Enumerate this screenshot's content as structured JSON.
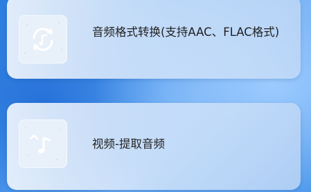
{
  "items": [
    {
      "label": "音频格式转换(支持AAC、FLAC格式)",
      "icon": "audio-convert-icon"
    },
    {
      "label": "视频-提取音频",
      "icon": "music-note-icon"
    }
  ],
  "colors": {
    "background_blue": "#3f8fe8",
    "card_background": "#dde9f8",
    "icon_tile_background": "#e8f0fa",
    "icon_stroke": "#ffffff",
    "text": "#222222"
  }
}
